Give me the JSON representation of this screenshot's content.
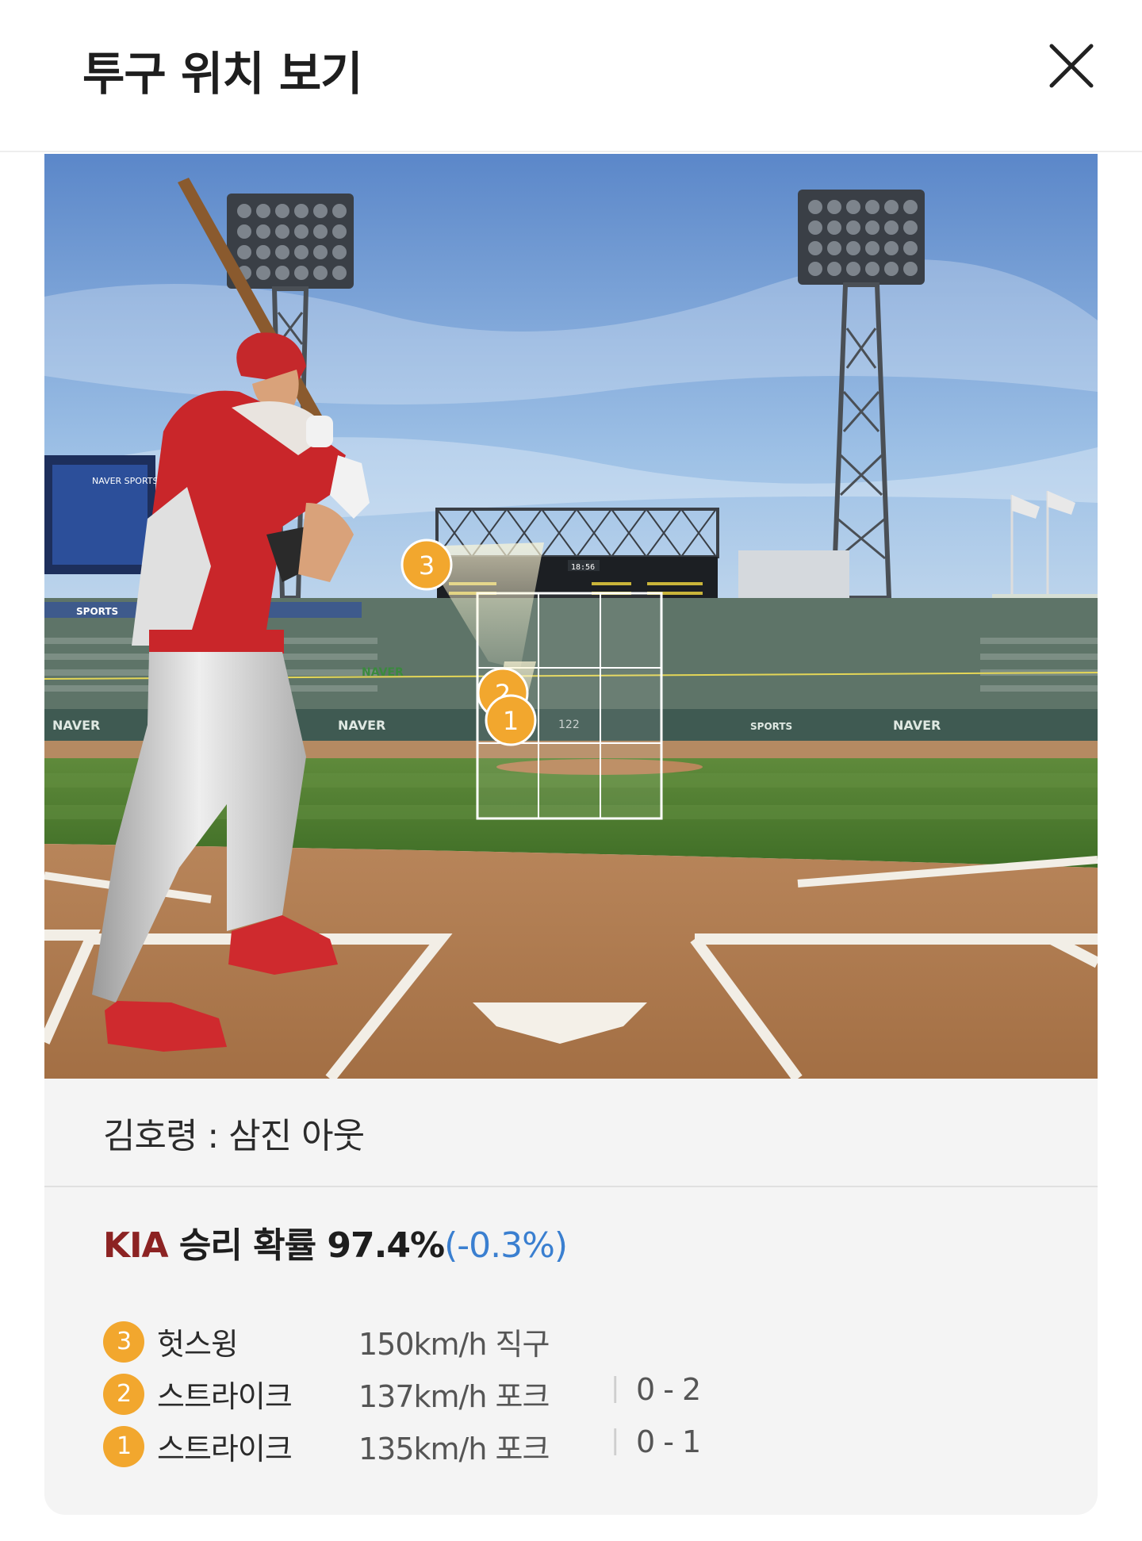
{
  "header": {
    "title": "투구 위치 보기"
  },
  "scene": {
    "ad_text": "NAVER",
    "ad_sports": "SPORTS",
    "speed_marker": "122",
    "scoreboard_time": "18:56",
    "green_sign": "N",
    "markers": [
      {
        "number": "3",
        "zone": "high-outside"
      },
      {
        "number": "2",
        "zone": "low-middle"
      },
      {
        "number": "1",
        "zone": "low-middle"
      }
    ]
  },
  "play": {
    "result": "김호령 : 삼진 아웃"
  },
  "win_probability": {
    "team": "KIA",
    "label": " 승리 확률 ",
    "value": "97.4%",
    "change": "(-0.3%)",
    "team_color": "#8c2323",
    "change_color": "#3a7fd0"
  },
  "pitches": [
    {
      "number": "3",
      "result": "헛스윙",
      "speed": "150km/h 직구",
      "count": ""
    },
    {
      "number": "2",
      "result": "스트라이크",
      "speed": "137km/h 포크",
      "count": "0 - 2"
    },
    {
      "number": "1",
      "result": "스트라이크",
      "speed": "135km/h 포크",
      "count": "0 - 1"
    }
  ],
  "colors": {
    "marker": "#f2a72e",
    "accent_team": "#8c2323"
  }
}
